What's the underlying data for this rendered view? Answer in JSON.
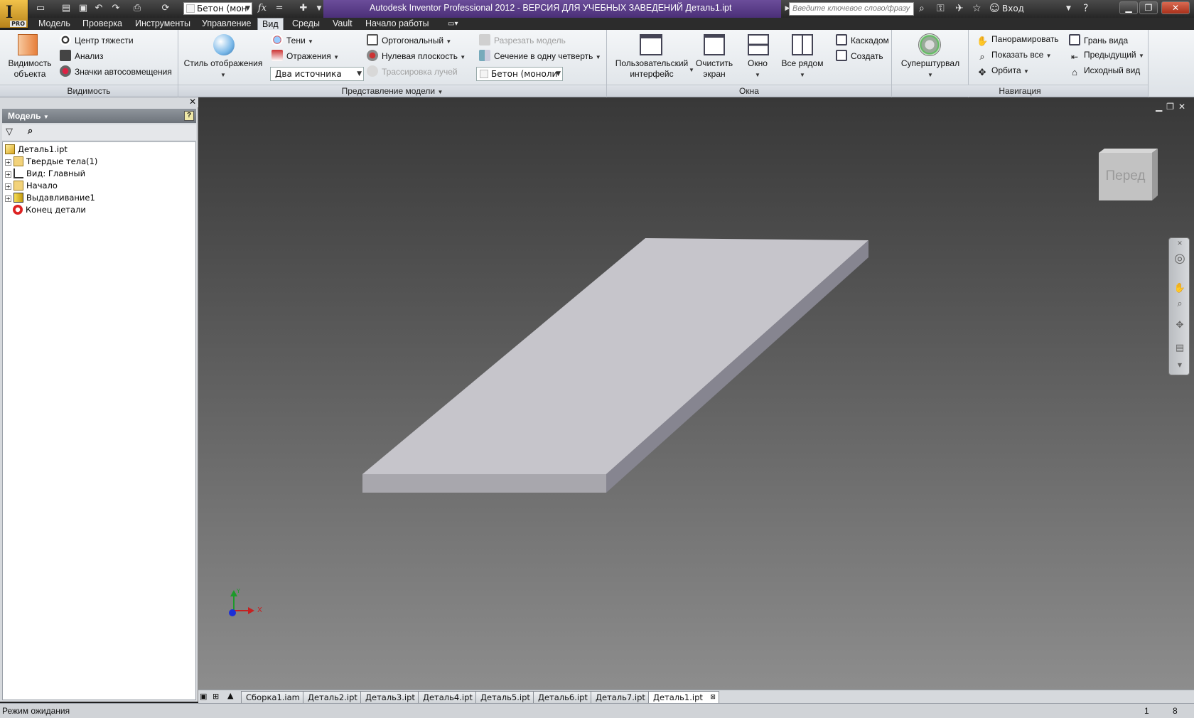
{
  "title_bar": {
    "app_badge": "PRO",
    "title": "Autodesk Inventor Professional 2012 - ВЕРСИЯ ДЛЯ УЧЕБНЫХ ЗАВЕДЕНИЙ   Деталь1.ipt",
    "material_value": "Бетон (мон",
    "search_placeholder": "Введите ключевое слово/фразу",
    "login": "Вход"
  },
  "ribbon_tabs": [
    "Модель",
    "Проверка",
    "Инструменты",
    "Управление",
    "Вид",
    "Среды",
    "Vault",
    "Начало работы"
  ],
  "active_tab": "Вид",
  "ribbon": {
    "visibility": {
      "object_visibility": "Видимость\nобъекта",
      "center_of_gravity": "Центр тяжести",
      "analysis": "Анализ",
      "autodrop_icons": "Значки автосовмещения",
      "title": "Видимость"
    },
    "model_view": {
      "visual_style": "Стиль отображения",
      "shadows": "Тени",
      "reflections": "Отражения",
      "lighting_value": "Два источника",
      "orthographic": "Ортогональный",
      "ground_plane": "Нулевая плоскость",
      "ray_tracing": "Трассировка лучей",
      "half_section": "Разрезать модель",
      "quarter_section": "Сечение в одну четверть",
      "material_value": "Бетон (моноли",
      "title": "Представление модели"
    },
    "windows": {
      "user_interface": "Пользовательский\nинтерфейс",
      "clean_screen": "Очистить\nэкран",
      "window": "Окно",
      "tile": "Все рядом",
      "cascade": "Каскадом",
      "new_window": "Создать",
      "title": "Окна"
    },
    "steering": {
      "label": "Суперштурвал"
    },
    "navigation": {
      "pan": "Панорамировать",
      "zoom_all": "Показать все",
      "orbit": "Орбита",
      "look_at": "Грань вида",
      "previous": "Предыдущий",
      "home": "Исходный вид",
      "title": "Навигация"
    }
  },
  "browser": {
    "header": "Модель",
    "help": "?",
    "tree": [
      "Деталь1.ipt",
      "Твердые тела(1)",
      "Вид: Главный",
      "Начало",
      "Выдавливание1",
      "Конец детали"
    ]
  },
  "viewport": {
    "viewcube_label": "Перед",
    "axis_x": "X",
    "axis_y": "Y"
  },
  "doc_tabs": [
    "Сборка1.iam",
    "Деталь2.ipt",
    "Деталь3.ipt",
    "Деталь4.ipt",
    "Деталь5.ipt",
    "Деталь6.ipt",
    "Деталь7.ipt",
    "Деталь1.ipt"
  ],
  "active_doc": "Деталь1.ipt",
  "status": {
    "message": "Режим ожидания",
    "count1": "1",
    "count2": "8"
  }
}
